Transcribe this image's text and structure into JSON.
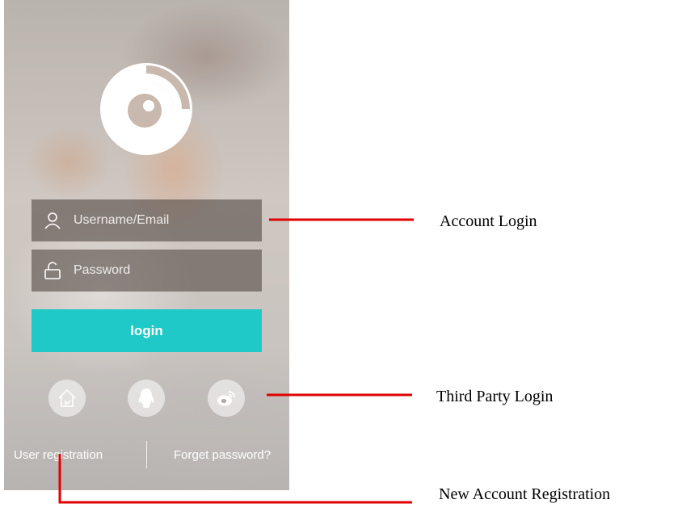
{
  "login_form": {
    "username_placeholder": "Username/Email",
    "password_placeholder": "Password",
    "login_label": "login"
  },
  "third_party": {
    "icons": [
      "home-icon",
      "qq-penguin-icon",
      "weibo-icon"
    ]
  },
  "footer": {
    "register_label": "User registration",
    "forgot_label": "Forget password?"
  },
  "annotations": {
    "account_login": "Account Login",
    "third_party_login": "Third Party Login",
    "new_account_registration": "New Account Registration"
  },
  "colors": {
    "accent": "#1fc9c7",
    "annotation_line": "#e00000"
  }
}
